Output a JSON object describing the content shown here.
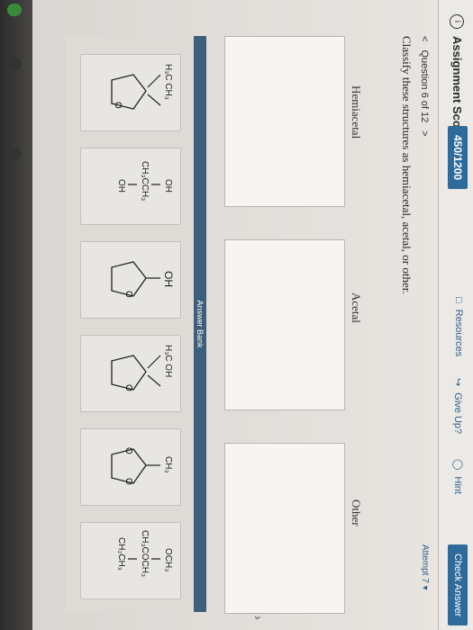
{
  "header": {
    "score_label": "Assignment Score:",
    "score_value": "450/1200",
    "resources": "Resources",
    "give_up": "Give Up?",
    "hint": "Hint",
    "check_answer": "Check Answer"
  },
  "question": {
    "nav_prev": "<",
    "title": "Question 6 of 12",
    "nav_next": ">",
    "attempt": "Attempt 7",
    "prompt": "Classify these structures as hemiacetal, acetal, or other."
  },
  "columns": [
    "Hemiacetal",
    "Acetal",
    "Other"
  ],
  "answer_bank": {
    "title": "Answer Bank",
    "cards": [
      {
        "top": "H₃C  CH₃",
        "bottom": ""
      },
      {
        "top": "OH",
        "mid": "CH₃CCH₃",
        "bottom": "OH"
      },
      {
        "top": "OH",
        "bottom": ""
      },
      {
        "top": "H₃C  OH",
        "bottom": ""
      },
      {
        "top": "CH₃",
        "bottom": ""
      },
      {
        "top": "OCH₃",
        "mid": "CH₃COCH₃",
        "bottom": "CH₂CH₃"
      }
    ]
  },
  "colors": {
    "accent": "#2f6b9a",
    "bank_bar": "#3d5f7c"
  },
  "icons": [
    "info-icon",
    "resources-icon",
    "give-up-icon",
    "hint-icon",
    "chevron-down-icon"
  ]
}
